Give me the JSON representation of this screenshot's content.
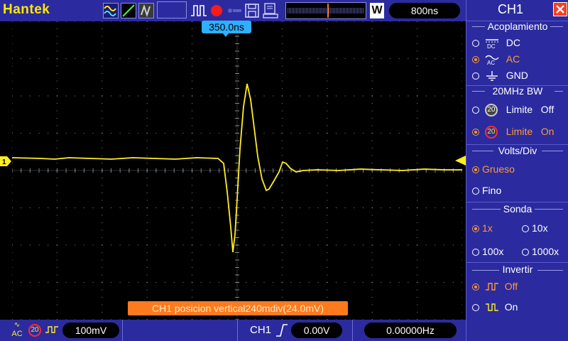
{
  "brand": "Hantek",
  "timebase": "800ns",
  "trigger_position": "350.0ns",
  "window_mode_label": "W",
  "status_message": "CH1  posicion  vertical240mdiv(24.0mV)",
  "bottom": {
    "volts_div": "100mV",
    "trigger_channel": "CH1",
    "trigger_level": "0.00V",
    "frequency": "0.00000Hz",
    "bw_badge": "20",
    "coupling_badge": "AC"
  },
  "channel_marker": "1",
  "panel": {
    "title": "CH1",
    "coupling": {
      "title": "Acoplamiento",
      "options": [
        {
          "label": "DC",
          "icon": "DC",
          "selected": false
        },
        {
          "label": "AC",
          "icon": "AC",
          "selected": true
        },
        {
          "label": "GND",
          "icon": "GND",
          "selected": false
        }
      ]
    },
    "bandwidth": {
      "title": "20MHz  BW",
      "badge": "20",
      "options": [
        {
          "label": "Limite   Off",
          "selected": false
        },
        {
          "label": "Limite   On",
          "selected": true
        }
      ]
    },
    "voltsdiv": {
      "title": "Volts/Div",
      "options": [
        {
          "label": "Grueso",
          "selected": true
        },
        {
          "label": "Fino",
          "selected": false
        }
      ]
    },
    "probe": {
      "title": "Sonda",
      "options": [
        {
          "label": "1x",
          "selected": true
        },
        {
          "label": "10x",
          "selected": false
        },
        {
          "label": "100x",
          "selected": false
        },
        {
          "label": "1000x",
          "selected": false
        }
      ]
    },
    "invert": {
      "title": "Invertir",
      "options": [
        {
          "label": "Off",
          "selected": true
        },
        {
          "label": "On",
          "selected": false
        }
      ]
    }
  },
  "colors": {
    "trace": "#ffee22",
    "accent": "#ff9a2e",
    "bar": "#2b2b9f",
    "close": "#ff3b1f"
  }
}
